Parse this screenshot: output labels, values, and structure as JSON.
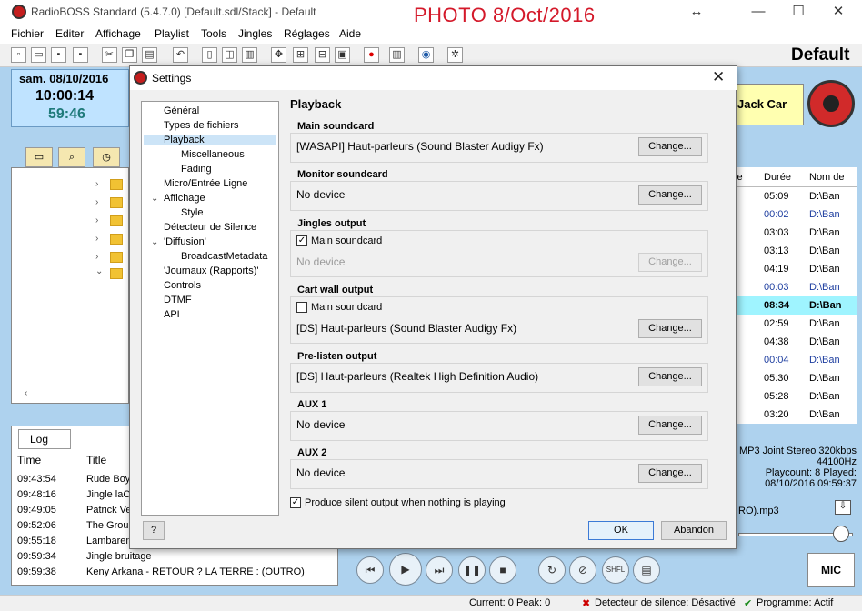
{
  "window": {
    "title": "RadioBOSS Standard (5.4.7.0) [Default.sdl/Stack] - Default",
    "photo_stamp": "PHOTO 8/Oct/2016",
    "controls": [
      "↔",
      "—",
      "☐",
      "✕"
    ]
  },
  "menu": [
    "Fichier",
    "Editer",
    "Affichage",
    "Playlist",
    "Tools",
    "Jingles",
    "Réglages",
    "Aide"
  ],
  "header": {
    "date": "sam. 08/10/2016",
    "time": "10:00:14",
    "remaining": "59:46",
    "profile": "Default",
    "cart_label": "Jack Car"
  },
  "log": {
    "tab": "Log",
    "columns": [
      "Time",
      "Title"
    ],
    "rows": [
      {
        "time": "09:43:54",
        "title": "Rude Boy"
      },
      {
        "time": "09:48:16",
        "title": "Jingle laCl"
      },
      {
        "time": "09:49:05",
        "title": "Patrick Ve"
      },
      {
        "time": "09:52:06",
        "title": "The Groun"
      },
      {
        "time": "09:55:18",
        "title": "Lambaren"
      },
      {
        "time": "09:59:34",
        "title": "Jingle bruitage"
      },
      {
        "time": "09:59:38",
        "title": "Keny Arkana - RETOUR ? LA TERRE : (OUTRO)"
      }
    ]
  },
  "playlist": {
    "columns": [
      "ie",
      "Durée",
      "Nom de"
    ],
    "rows": [
      {
        "dur": "05:09",
        "path": "D:\\Ban",
        "style": ""
      },
      {
        "dur": "00:02",
        "path": "D:\\Ban",
        "style": "blue"
      },
      {
        "dur": "03:03",
        "path": "D:\\Ban",
        "style": ""
      },
      {
        "dur": "03:13",
        "path": "D:\\Ban",
        "style": ""
      },
      {
        "dur": "04:19",
        "path": "D:\\Ban",
        "style": ""
      },
      {
        "dur": "00:03",
        "path": "D:\\Ban",
        "style": "blue"
      },
      {
        "dur": "08:34",
        "path": "D:\\Ban",
        "style": "hl"
      },
      {
        "dur": "02:59",
        "path": "D:\\Ban",
        "style": ""
      },
      {
        "dur": "04:38",
        "path": "D:\\Ban",
        "style": ""
      },
      {
        "dur": "00:04",
        "path": "D:\\Ban",
        "style": "blue"
      },
      {
        "dur": "05:30",
        "path": "D:\\Ban",
        "style": ""
      },
      {
        "dur": "05:28",
        "path": "D:\\Ban",
        "style": ""
      },
      {
        "dur": "03:20",
        "path": "D:\\Ban",
        "style": ""
      }
    ]
  },
  "track_info": {
    "format": "MP3 Joint Stereo 320kbps",
    "rate": "44100Hz",
    "playcount": "Playcount: 8  Played:",
    "played": "08/10/2016 09:59:37",
    "file": "RO).mp3"
  },
  "player": {
    "mic_label": "MIC",
    "shfl_label": "SHFL"
  },
  "status": {
    "current": "Current: 0  Peak: 0",
    "silence": "Detecteur de silence: Désactivé",
    "program": "Programme: Actif"
  },
  "dialog": {
    "title": "Settings",
    "nav": [
      {
        "label": "Général",
        "indent": 0
      },
      {
        "label": "Types de fichiers",
        "indent": 0
      },
      {
        "label": "Playback",
        "indent": 0,
        "expanded": true,
        "selected": true
      },
      {
        "label": "Miscellaneous",
        "indent": 1
      },
      {
        "label": "Fading",
        "indent": 1
      },
      {
        "label": "Micro/Entrée Ligne",
        "indent": 0
      },
      {
        "label": "Affichage",
        "indent": 0,
        "expanded": true
      },
      {
        "label": "Style",
        "indent": 1
      },
      {
        "label": "Détecteur de Silence",
        "indent": 0
      },
      {
        "label": "'Diffusion'",
        "indent": 0,
        "expanded": true
      },
      {
        "label": "BroadcastMetadata",
        "indent": 1
      },
      {
        "label": "'Journaux (Rapports)'",
        "indent": 0
      },
      {
        "label": "Controls",
        "indent": 0
      },
      {
        "label": "DTMF",
        "indent": 0
      },
      {
        "label": "API",
        "indent": 0
      }
    ],
    "page_title": "Playback",
    "change_label": "Change...",
    "groups": [
      {
        "title": "Main soundcard",
        "value": "[WASAPI] Haut-parleurs (Sound Blaster Audigy Fx)",
        "checkbox": null,
        "disabled": false
      },
      {
        "title": "Monitor soundcard",
        "value": "No device",
        "checkbox": null,
        "disabled": false
      },
      {
        "title": "Jingles output",
        "value": "No device",
        "checkbox": {
          "label": "Main soundcard",
          "checked": true
        },
        "disabled": true
      },
      {
        "title": "Cart wall output",
        "value": "[DS] Haut-parleurs (Sound Blaster Audigy Fx)",
        "checkbox": {
          "label": "Main soundcard",
          "checked": false
        },
        "disabled": false
      },
      {
        "title": "Pre-listen output",
        "value": "[DS] Haut-parleurs (Realtek High Definition Audio)",
        "checkbox": null,
        "disabled": false
      },
      {
        "title": "AUX 1",
        "value": "No device",
        "checkbox": null,
        "disabled": false
      },
      {
        "title": "AUX 2",
        "value": "No device",
        "checkbox": null,
        "disabled": false
      }
    ],
    "silent_output": {
      "label": "Produce silent output when nothing is playing",
      "checked": true
    },
    "ok_label": "OK",
    "cancel_label": "Abandon",
    "help_label": "?"
  }
}
